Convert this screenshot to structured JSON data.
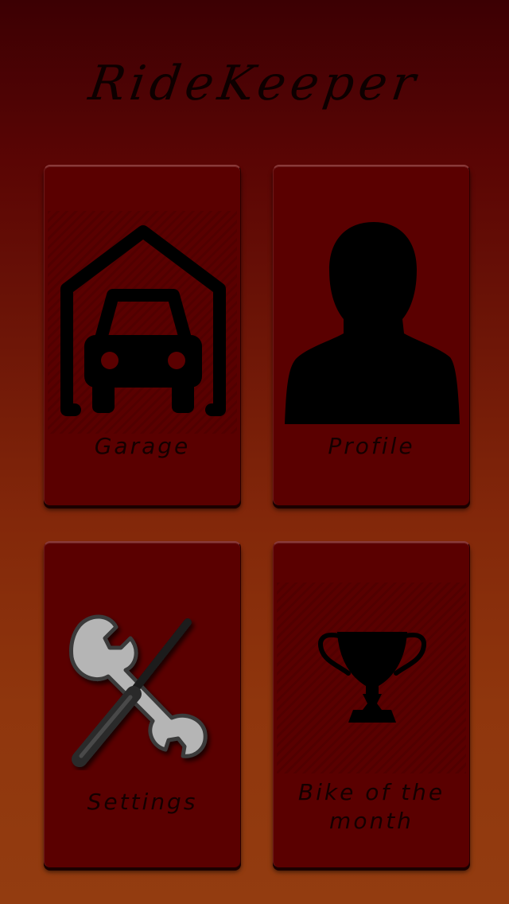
{
  "app": {
    "title": "RideKeeper"
  },
  "tiles": [
    {
      "label": "Garage",
      "icon": "garage-car-icon"
    },
    {
      "label": "Profile",
      "icon": "person-silhouette-icon"
    },
    {
      "label": "Settings",
      "icon": "wrench-screwdriver-icon"
    },
    {
      "label": "Bike of the month",
      "icon": "trophy-icon"
    }
  ],
  "colors": {
    "tile_background": "#5a0000",
    "background_top": "#3c0003",
    "background_bottom": "#933c10",
    "icon_color": "#000000"
  }
}
